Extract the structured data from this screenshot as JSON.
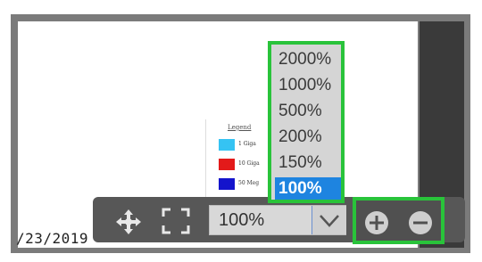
{
  "date_text": "/23/2019",
  "legend": {
    "title": "Legend",
    "items": [
      {
        "label": "1 Giga",
        "color": "#35c3f3"
      },
      {
        "label": "10 Giga",
        "color": "#e31a1a"
      },
      {
        "label": "50 Meg",
        "color": "#1414cc"
      }
    ]
  },
  "toolbar": {
    "zoom_value": "100%",
    "zoom_options": [
      "2000%",
      "1000%",
      "500%",
      "200%",
      "150%",
      "100%"
    ],
    "selected_option": "100%"
  },
  "icons": {
    "move": "move-arrows-icon",
    "fit": "fit-to-screen-icon",
    "dropdown": "chevron-down-icon",
    "zoom_in": "plus-circle-icon",
    "zoom_out": "minus-circle-icon"
  },
  "colors": {
    "highlight": "#29c33a",
    "selected": "#1e84e0",
    "toolbar": "#575757"
  }
}
